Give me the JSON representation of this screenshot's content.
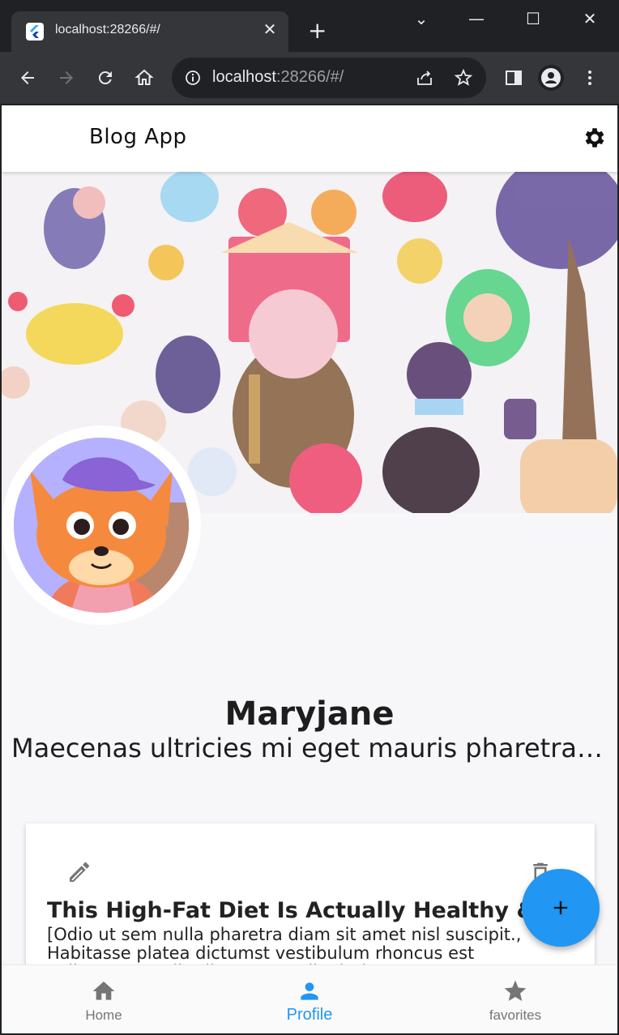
{
  "browser": {
    "tab_title": "localhost:28266/#/",
    "url_host": "localhost",
    "url_rest": ":28266/#/"
  },
  "app": {
    "title": "Blog App"
  },
  "profile": {
    "name": "Maryjane",
    "bio": "Maecenas ultricies mi eget mauris pharetra et ultrices neque"
  },
  "post": {
    "title": "This High-Fat Diet Is Actually Healthy & Sustainable",
    "body": "[Odio ut sem nulla pharetra diam sit amet nisl suscipit., Habitasse platea dictumst vestibulum rhoncus est pellentesque elit ullamcorper dignissim."
  },
  "bottom_nav": {
    "items": [
      {
        "label": "Home",
        "icon": "home-icon",
        "active": false
      },
      {
        "label": "Profile",
        "icon": "person-icon",
        "active": true
      },
      {
        "label": "favorites",
        "icon": "star-icon",
        "active": false
      }
    ]
  },
  "colors": {
    "accent": "#2196f3",
    "inactive": "#757575",
    "chrome_dark": "#202124",
    "chrome_toolbar": "#35363a"
  }
}
